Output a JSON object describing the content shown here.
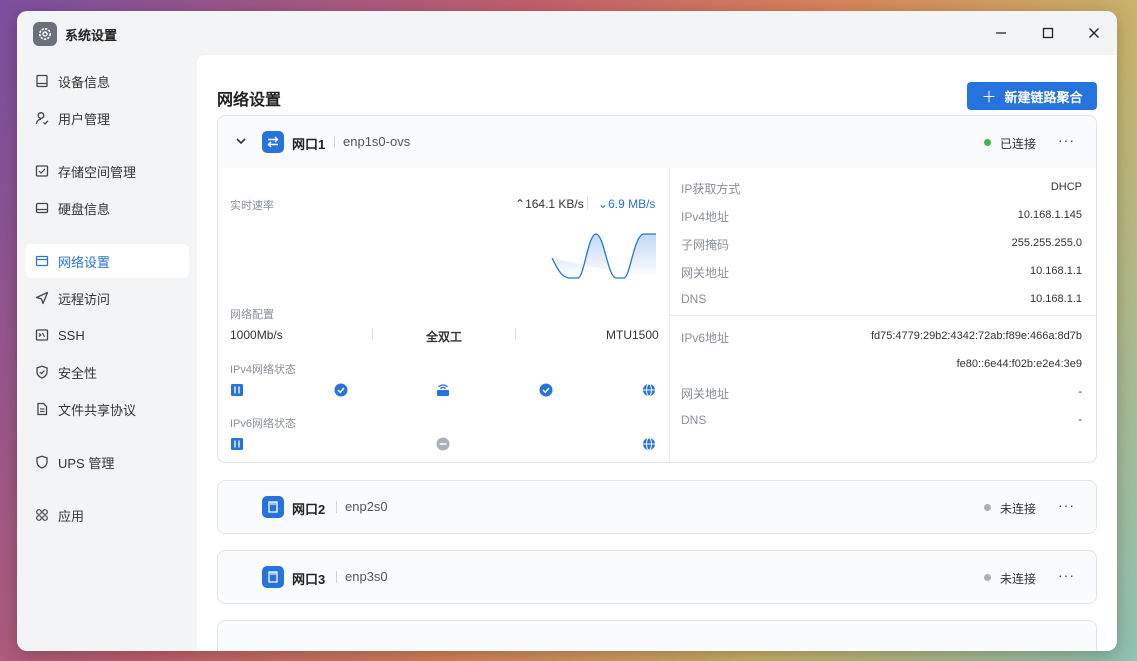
{
  "app": {
    "title": "系统设置"
  },
  "sidebar": {
    "items": [
      {
        "label": "设备信息",
        "icon": "device-icon"
      },
      {
        "label": "用户管理",
        "icon": "user-icon"
      },
      {
        "label": "存储空间管理",
        "icon": "storage-icon"
      },
      {
        "label": "硬盘信息",
        "icon": "disk-icon"
      },
      {
        "label": "网络设置",
        "icon": "network-icon",
        "active": true
      },
      {
        "label": "远程访问",
        "icon": "send-icon"
      },
      {
        "label": "SSH",
        "icon": "terminal-icon"
      },
      {
        "label": "安全性",
        "icon": "shield-icon"
      },
      {
        "label": "文件共享协议",
        "icon": "file-icon"
      },
      {
        "label": "UPS 管理",
        "icon": "ups-shield-icon"
      },
      {
        "label": "应用",
        "icon": "apps-icon"
      }
    ]
  },
  "page": {
    "title": "网络设置",
    "new_bond_label": "新建链路聚合"
  },
  "ports": [
    {
      "name": "网口1",
      "device": "enp1s0-ovs",
      "status": "已连接",
      "status_color": "#3fb34f",
      "realtime_label": "实时速率",
      "upload": "164.1 KB/s",
      "download": "6.9 MB/s",
      "config_label": "网络配置",
      "speed": "1000Mb/s",
      "duplex": "全双工",
      "mtu": "MTU1500",
      "ipv4_state_label": "IPv4网络状态",
      "ipv6_state_label": "IPv6网络状态",
      "ipv4": [
        {
          "label": "IP获取方式",
          "value": "DHCP"
        },
        {
          "label": "IPv4地址",
          "value": "10.168.1.145"
        },
        {
          "label": "子网掩码",
          "value": "255.255.255.0"
        },
        {
          "label": "网关地址",
          "value": "10.168.1.1"
        },
        {
          "label": "DNS",
          "value": "10.168.1.1"
        }
      ],
      "ipv6": {
        "addr_label": "IPv6地址",
        "addr1": "fd75:4779:29b2:4342:72ab:f89e:466a:8d7b",
        "addr2": "fe80::6e44:f02b:e2e4:3e9",
        "gw_label": "网关地址",
        "gw_value": "-",
        "dns_label": "DNS",
        "dns_value": "-"
      }
    },
    {
      "name": "网口2",
      "device": "enp2s0",
      "status": "未连接",
      "status_color": "#a9b0ba"
    },
    {
      "name": "网口3",
      "device": "enp3s0",
      "status": "未连接",
      "status_color": "#a9b0ba"
    }
  ],
  "colors": {
    "accent": "#2673dd"
  }
}
